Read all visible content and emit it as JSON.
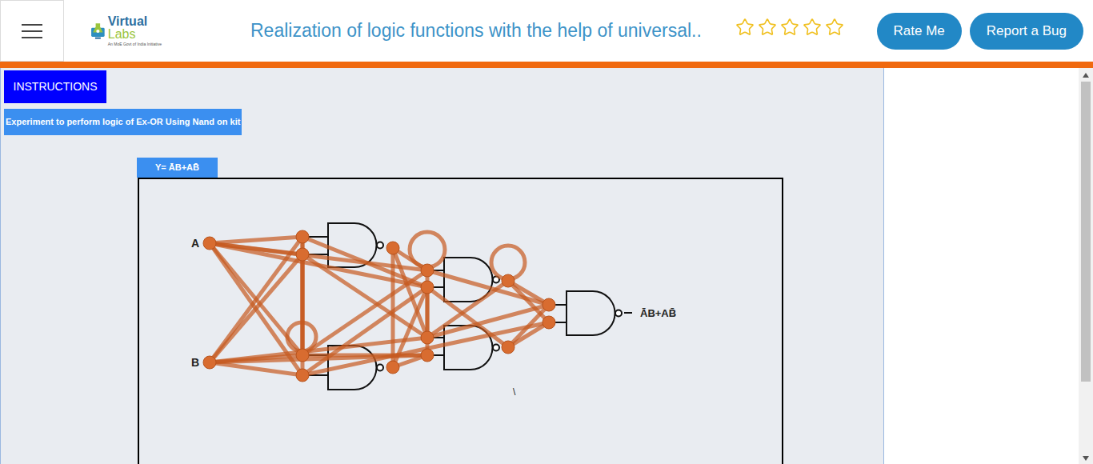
{
  "header": {
    "logo": {
      "title": "Virtual",
      "subtitle": "Labs",
      "tagline": "An MoE Govt of India Initiative"
    },
    "title": "Realization of logic functions with the help of universal..",
    "rating": {
      "stars": 0,
      "total": 5
    },
    "buttons": [
      "Rate Me",
      "Report a Bug"
    ]
  },
  "instructions_button": "INSTRUCTIONS",
  "experiment_label": "Experiment to perform logic of Ex-OR Using Nand on kit",
  "formula_tab": "Y= ĀB+AB̄",
  "diagram": {
    "inputs": [
      "A",
      "B"
    ],
    "output": "ĀB+AB̄",
    "stray_mark": "\\"
  }
}
